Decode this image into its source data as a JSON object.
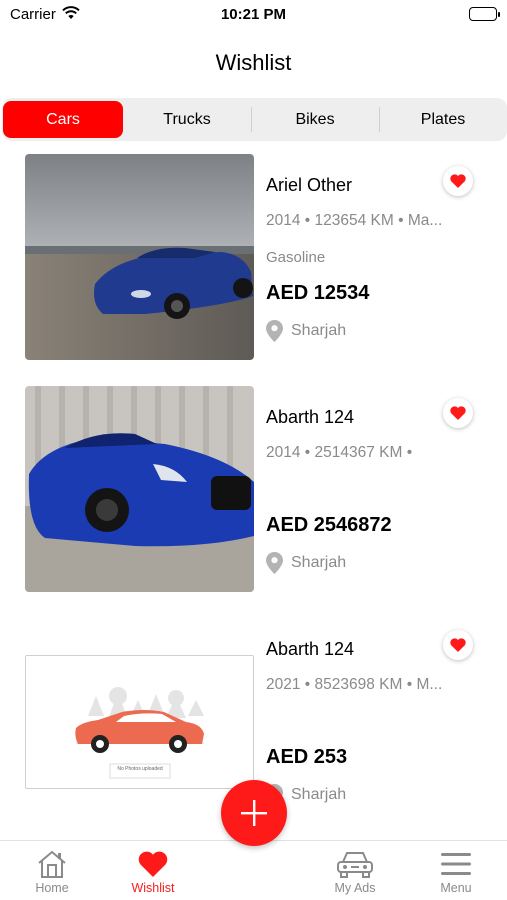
{
  "status_bar": {
    "carrier": "Carrier",
    "time": "10:21 PM"
  },
  "header": {
    "title": "Wishlist"
  },
  "segments": [
    {
      "label": "Cars",
      "active": true
    },
    {
      "label": "Trucks",
      "active": false
    },
    {
      "label": "Bikes",
      "active": false
    },
    {
      "label": "Plates",
      "active": false
    }
  ],
  "listings": [
    {
      "name": "Ariel Other",
      "meta": "2014 • 123654 KM • Ma...",
      "fuel": "Gasoline",
      "price": "AED 12534",
      "location": "Sharjah"
    },
    {
      "name": "Abarth 124",
      "meta": "2014 • 2514367 KM •",
      "fuel": "",
      "price": "AED 2546872",
      "location": "Sharjah"
    },
    {
      "name": "Abarth 124",
      "meta": "2021 • 8523698 KM • M...",
      "fuel": "",
      "price": "AED 253",
      "location": "Sharjah",
      "placeholder_text": "No Photos uploaded"
    }
  ],
  "tabbar": [
    {
      "label": "Home",
      "icon": "home-icon",
      "active": false
    },
    {
      "label": "Wishlist",
      "icon": "heart-icon",
      "active": true
    },
    {
      "label": "My Ads",
      "icon": "car-icon",
      "active": false
    },
    {
      "label": "Menu",
      "icon": "menu-icon",
      "active": false
    }
  ],
  "colors": {
    "accent": "#ff1a1a",
    "segment_bg": "#eeeeee",
    "muted_text": "#8a8a8a"
  }
}
